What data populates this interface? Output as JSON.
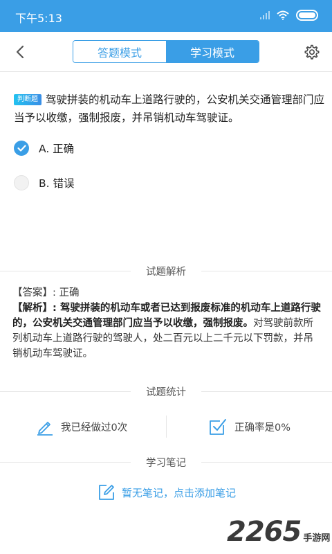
{
  "status_bar": {
    "time": "下午5:13"
  },
  "nav": {
    "tab_answer": "答题模式",
    "tab_study": "学习模式",
    "active_tab": "学习模式"
  },
  "question": {
    "type_badge": "判断题",
    "text": "驾驶拼装的机动车上道路行驶的，公安机关交通管理部门应当予以收缴，强制报废，并吊销机动车驾驶证。"
  },
  "options": [
    {
      "label": "A. 正确",
      "selected": true
    },
    {
      "label": "B. 错误",
      "selected": false
    }
  ],
  "analysis": {
    "section_title": "试题解析",
    "answer_prefix": "【答案】: ",
    "answer": "正确",
    "explain_prefix": "【解析】: ",
    "explain_bold": "驾驶拼装的机动车或者已达到报废标准的机动车上道路行驶的，公安机关交通管理部门应当予以收缴，强制报废。",
    "explain_rest": "对驾驶前款所列机动车上道路行驶的驾驶人，处二百元以上二千元以下罚款，并吊销机动车驾驶证。"
  },
  "stats": {
    "section_title": "试题统计",
    "done_text": "我已经做过0次",
    "accuracy_text": "正确率是0%"
  },
  "notes": {
    "section_title": "学习笔记",
    "empty_text": "暂无笔记，点击添加笔记"
  },
  "watermark": {
    "number": "2265",
    "text": "手游网"
  },
  "colors": {
    "accent": "#3a9ee6",
    "status_bar": "#3a9ee6"
  },
  "icons": {
    "back": "chevron-left-icon",
    "settings": "gear-icon",
    "edit": "pencil-icon",
    "check": "checkbox-check-icon",
    "note": "note-edit-icon"
  }
}
